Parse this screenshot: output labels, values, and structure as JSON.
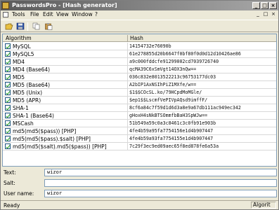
{
  "window": {
    "title": "PasswordsPro - [Hash generator]",
    "buttons": {
      "minimize": "_",
      "maximize": "□",
      "close": "×"
    }
  },
  "menu": {
    "items": [
      "Tools",
      "File",
      "Edit",
      "View",
      "Window",
      "?"
    ],
    "mdi_buttons": {
      "minimize": "_",
      "restore": "□",
      "close": "×"
    }
  },
  "toolbar": {
    "icons": [
      "open-folder-icon",
      "save-icon",
      "copy-icon",
      "paste-icon"
    ]
  },
  "grid": {
    "columns": [
      "Algorithm",
      "Hash"
    ],
    "rows": [
      {
        "algorithm": "MySQL",
        "hash": "14154732e76090b"
      },
      {
        "algorithm": "MySQL5",
        "hash": "61e278855d20b6647f0bf80f0d0d12d10426ae86"
      },
      {
        "algorithm": "MD4",
        "hash": "a9c000fddcfe91299002cd7039726740"
      },
      {
        "algorithm": "MD4 (Base64)",
        "hash": "qcMA39C6xSmVgt14OX3nQw=="
      },
      {
        "algorithm": "MD5",
        "hash": "036c832e8013522213c96753177dc03"
      },
      {
        "algorithm": "MD5 (Base64)",
        "hash": "A2bIP1AxNSIhPiZ1MXfe/w=="
      },
      {
        "algorithm": "MD5 (Unix)",
        "hash": "$1$$COcSL.ko/79HCpdMoMGle/"
      },
      {
        "algorithm": "MD5 (APR)",
        "hash": "$ep1$$LscmfVePIVpAQsd9imffF/"
      },
      {
        "algorithm": "SHA-1",
        "hash": "8cf6a84c7f59d1d6d3a8e9a67db111ac949ec342"
      },
      {
        "algorithm": "SHA-1 (Base64)",
        "hash": "gHoxH4sNkBTSOmmfbBaH3SpWJw=="
      },
      {
        "algorithm": "MSCash",
        "hash": "51b549a59c0a3c8461c3c0fb91e903b"
      },
      {
        "algorithm": "md5(md5($pass)) [PHP]",
        "hash": "4fe4b59a95fa7754156e1d4b907447"
      },
      {
        "algorithm": "md5(md5($pass).$salt) [PHP]",
        "hash": "4fe4b59a93fa7754155e1d4b907447"
      },
      {
        "algorithm": "md5(md5($salt).md5($pass)) [PHP]",
        "hash": "7c29f3ec9ed09aec65f8ed878fe6a53a"
      }
    ]
  },
  "fields": {
    "text": {
      "label": "Text:",
      "value": "wizor"
    },
    "salt": {
      "label": "Salt:",
      "value": ""
    },
    "username": {
      "label": "User name:",
      "value": "wizor"
    }
  },
  "status": {
    "text": "Ready",
    "panel": "Algorit"
  }
}
